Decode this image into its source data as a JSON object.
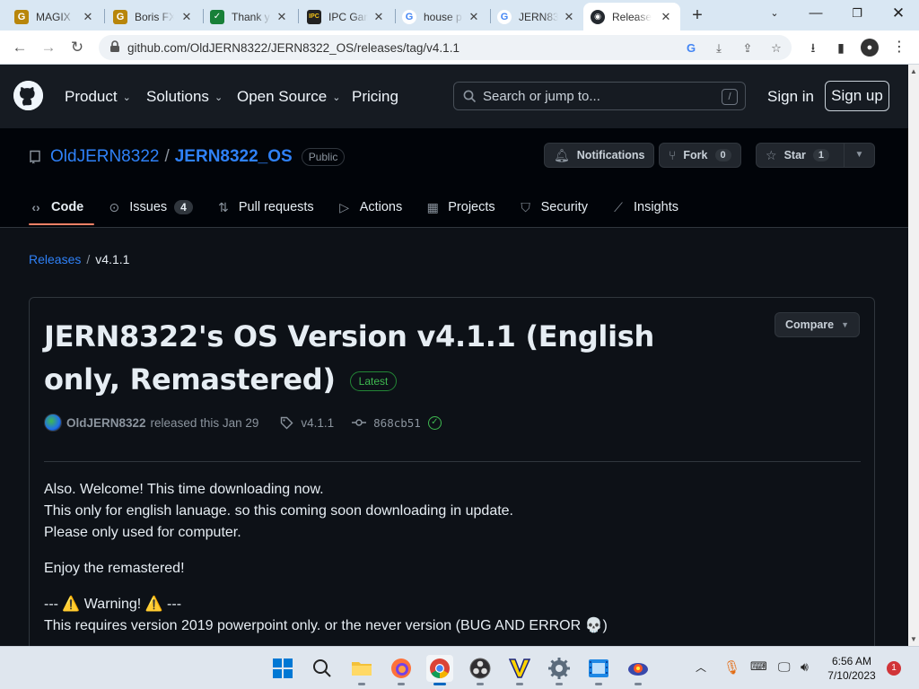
{
  "browser": {
    "tabs": [
      {
        "title": "MAGIX",
        "icon": "magix-g-icon"
      },
      {
        "title": "Boris FX",
        "icon": "borisfx-g-icon"
      },
      {
        "title": "Thank y",
        "icon": "sheets-icon"
      },
      {
        "title": "IPC Gam",
        "icon": "ipc-games-icon"
      },
      {
        "title": "house p",
        "icon": "google-icon"
      },
      {
        "title": "JERN83",
        "icon": "google-icon"
      },
      {
        "title": "Release",
        "icon": "github-icon"
      }
    ],
    "url": "github.com/OldJERN8322/JERN8322_OS/releases/tag/v4.1.1"
  },
  "header": {
    "nav": [
      {
        "label": "Product",
        "has_menu": true
      },
      {
        "label": "Solutions",
        "has_menu": true
      },
      {
        "label": "Open Source",
        "has_menu": true
      },
      {
        "label": "Pricing",
        "has_menu": false
      }
    ],
    "search_placeholder": "Search or jump to...",
    "search_shortcut": "/",
    "sign_in": "Sign in",
    "sign_up": "Sign up"
  },
  "repo": {
    "owner": "OldJERN8322",
    "separator": "/",
    "name": "JERN8322_OS",
    "visibility": "Public",
    "notifications_label": "Notifications",
    "fork_label": "Fork",
    "fork_count": "0",
    "star_label": "Star",
    "star_count": "1",
    "tabs": [
      {
        "label": "Code",
        "icon": "code-icon",
        "active": true
      },
      {
        "label": "Issues",
        "icon": "issue-icon",
        "count": "4"
      },
      {
        "label": "Pull requests",
        "icon": "pull-request-icon"
      },
      {
        "label": "Actions",
        "icon": "play-icon"
      },
      {
        "label": "Projects",
        "icon": "table-icon"
      },
      {
        "label": "Security",
        "icon": "shield-icon"
      },
      {
        "label": "Insights",
        "icon": "graph-icon"
      }
    ]
  },
  "breadcrumb": {
    "releases": "Releases",
    "separator": "/",
    "current": "v4.1.1"
  },
  "release": {
    "title": "JERN8322's OS Version v4.1.1 (English only, Remastered)",
    "latest_badge": "Latest",
    "compare_label": "Compare",
    "author": "OldJERN8322",
    "released_text": "released this Jan 29",
    "tag": "v4.1.1",
    "commit": "868cb51",
    "body": {
      "p1_l1": "Also. Welcome! This time downloading now.",
      "p1_l2": "This only for english lanuage. so this coming soon downloading in update.",
      "p1_l3": "Please only used for computer.",
      "p2": "Enjoy the remastered!",
      "p3_l1": "--- ⚠️ Warning! ⚠️ ---",
      "p3_l2": "This requires version 2019 powerpoint only. or the never version (BUG AND ERROR 💀)"
    }
  },
  "taskbar": {
    "time": "6:56 AM",
    "date": "7/10/2023",
    "notification_count": "1"
  },
  "colors": {
    "bg": "#0d1117",
    "header_bg": "#161b22",
    "link": "#2f81f7",
    "latest_green": "#3fb950",
    "tab_underline": "#f78166"
  }
}
